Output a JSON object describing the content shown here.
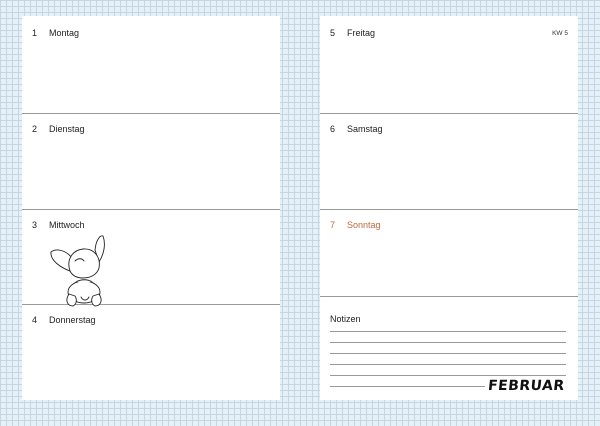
{
  "left_days": [
    {
      "num": "1",
      "name": "Montag"
    },
    {
      "num": "2",
      "name": "Dienstag"
    },
    {
      "num": "3",
      "name": "Mittwoch"
    },
    {
      "num": "4",
      "name": "Donnerstag"
    }
  ],
  "right_days": [
    {
      "num": "5",
      "name": "Freitag"
    },
    {
      "num": "6",
      "name": "Samstag"
    },
    {
      "num": "7",
      "name": "Sonntag"
    }
  ],
  "week_label": "KW 5",
  "notes_label": "Notizen",
  "month": "FEBRUAR",
  "colors": {
    "sunday": "#c0683c",
    "grid": "#c2d6e6"
  }
}
